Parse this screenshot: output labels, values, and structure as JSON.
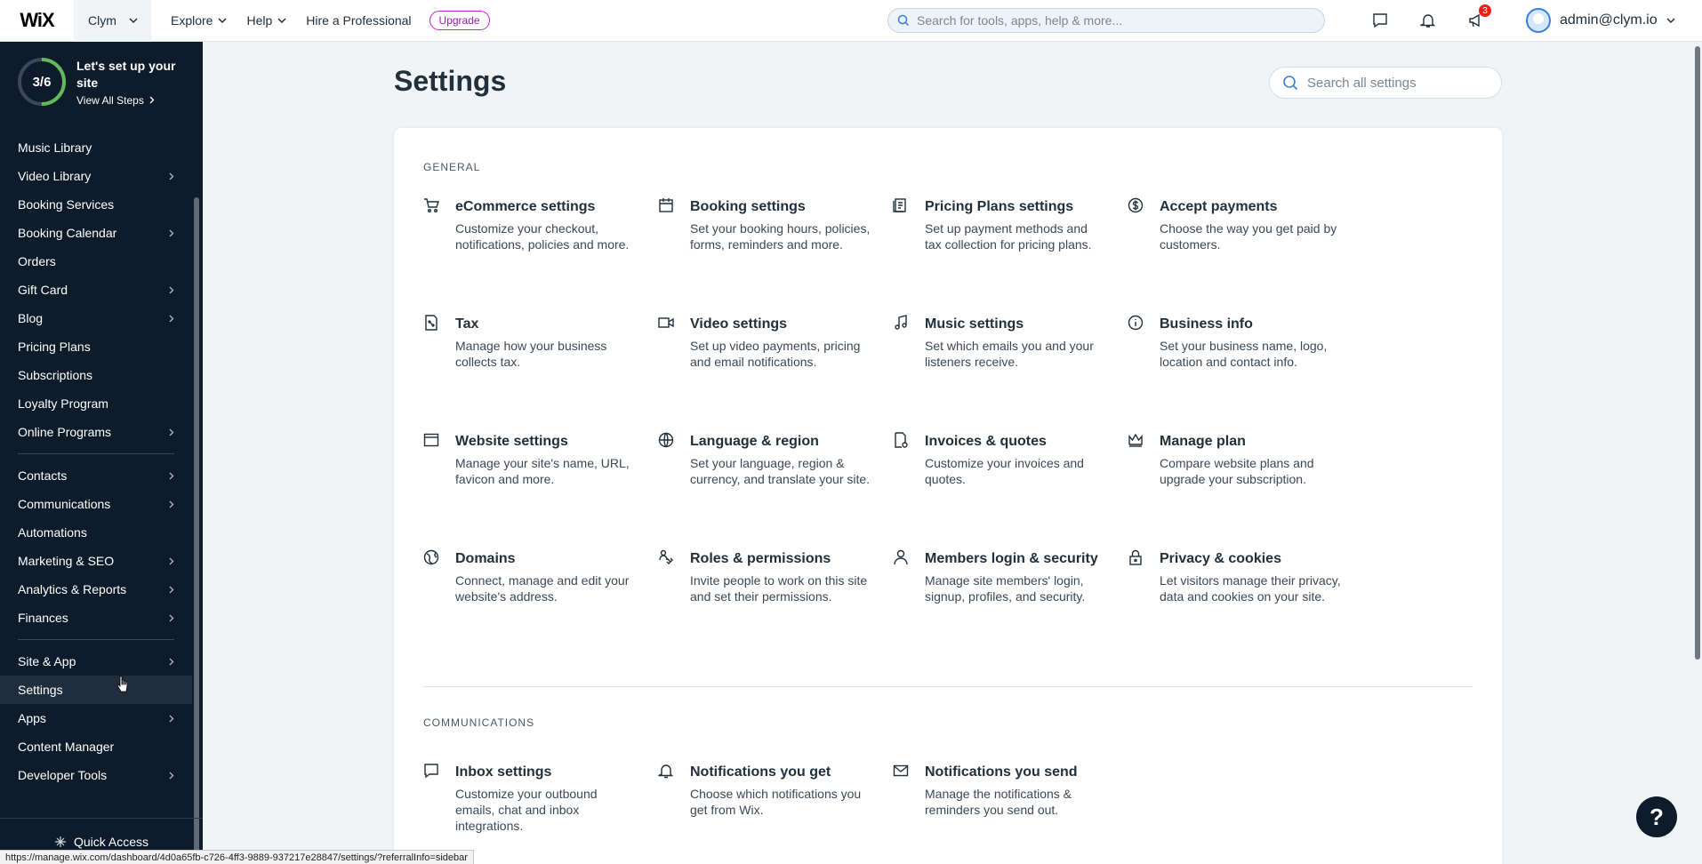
{
  "header": {
    "logo": "WiX",
    "site_name": "Clym",
    "nav": [
      {
        "label": "Explore"
      },
      {
        "label": "Help"
      },
      {
        "label": "Hire a Professional"
      }
    ],
    "upgrade_label": "Upgrade",
    "search_placeholder": "Search for tools, apps, help & more...",
    "notification_count": "3",
    "user_email": "admin@clym.io"
  },
  "sidebar": {
    "setup_progress": "3/6",
    "setup_progress_fraction": 0.5,
    "setup_title": "Let's set up your site",
    "setup_link": "View All Steps",
    "groups": [
      [
        {
          "label": "Music Library",
          "chevron": false
        },
        {
          "label": "Video Library",
          "chevron": true
        },
        {
          "label": "Booking Services",
          "chevron": false
        },
        {
          "label": "Booking Calendar",
          "chevron": true
        },
        {
          "label": "Orders",
          "chevron": false
        },
        {
          "label": "Gift Card",
          "chevron": true
        },
        {
          "label": "Blog",
          "chevron": true
        },
        {
          "label": "Pricing Plans",
          "chevron": false
        },
        {
          "label": "Subscriptions",
          "chevron": false
        },
        {
          "label": "Loyalty Program",
          "chevron": false
        },
        {
          "label": "Online Programs",
          "chevron": true
        }
      ],
      [
        {
          "label": "Contacts",
          "chevron": true
        },
        {
          "label": "Communications",
          "chevron": true
        },
        {
          "label": "Automations",
          "chevron": false
        },
        {
          "label": "Marketing & SEO",
          "chevron": true
        },
        {
          "label": "Analytics & Reports",
          "chevron": true
        },
        {
          "label": "Finances",
          "chevron": true
        }
      ],
      [
        {
          "label": "Site & App",
          "chevron": true
        },
        {
          "label": "Settings",
          "chevron": false,
          "active": true
        },
        {
          "label": "Apps",
          "chevron": true
        },
        {
          "label": "Content Manager",
          "chevron": false
        },
        {
          "label": "Developer Tools",
          "chevron": true
        }
      ]
    ],
    "quick_access": "Quick Access"
  },
  "main": {
    "title": "Settings",
    "search_placeholder": "Search all settings",
    "sections": [
      {
        "label": "GENERAL",
        "cards": [
          {
            "icon": "cart-icon",
            "title": "eCommerce settings",
            "desc": "Customize your checkout, notifications, policies and more."
          },
          {
            "icon": "calendar-icon",
            "title": "Booking settings",
            "desc": "Set your booking hours, policies, forms, reminders and more."
          },
          {
            "icon": "pricing-plan-icon",
            "title": "Pricing Plans settings",
            "desc": "Set up payment methods and tax collection for pricing plans."
          },
          {
            "icon": "dollar-icon",
            "title": "Accept payments",
            "desc": "Choose the way you get paid by customers."
          },
          {
            "icon": "tax-icon",
            "title": "Tax",
            "desc": "Manage how your business collects tax."
          },
          {
            "icon": "video-icon",
            "title": "Video settings",
            "desc": "Set up video payments, pricing and email notifications."
          },
          {
            "icon": "music-note-icon",
            "title": "Music settings",
            "desc": "Set which emails you and your listeners receive."
          },
          {
            "icon": "info-icon",
            "title": "Business info",
            "desc": "Set your business name, logo, location and contact info."
          },
          {
            "icon": "browser-window-icon",
            "title": "Website settings",
            "desc": "Manage your site's name, URL, favicon and more."
          },
          {
            "icon": "globe-icon",
            "title": "Language & region",
            "desc": "Set your language, region & currency, and translate your site."
          },
          {
            "icon": "invoice-icon",
            "title": "Invoices & quotes",
            "desc": "Customize your invoices and quotes."
          },
          {
            "icon": "crown-icon",
            "title": "Manage plan",
            "desc": "Compare website plans and upgrade your subscription."
          },
          {
            "icon": "domain-icon",
            "title": "Domains",
            "desc": "Connect, manage and edit your website's address."
          },
          {
            "icon": "roles-icon",
            "title": "Roles & permissions",
            "desc": "Invite people to work on this site and set their permissions."
          },
          {
            "icon": "member-icon",
            "title": "Members login & security",
            "desc": "Manage site members' login, signup, profiles, and security."
          },
          {
            "icon": "lock-icon",
            "title": "Privacy & cookies",
            "desc": "Let visitors manage their privacy, data and cookies on your site."
          }
        ]
      },
      {
        "label": "COMMUNICATIONS",
        "cards": [
          {
            "icon": "chat-icon",
            "title": "Inbox settings",
            "desc": "Customize your outbound emails, chat and inbox integrations."
          },
          {
            "icon": "bell-icon",
            "title": "Notifications you get",
            "desc": "Choose which notifications you get from Wix."
          },
          {
            "icon": "envelope-icon",
            "title": "Notifications you send",
            "desc": "Manage the notifications & reminders you send out."
          }
        ]
      }
    ]
  },
  "help_label": "?",
  "status_url": "https://manage.wix.com/dashboard/4d0a65fb-c726-4ff3-9889-937217e28847/settings/?referralInfo=sidebar"
}
